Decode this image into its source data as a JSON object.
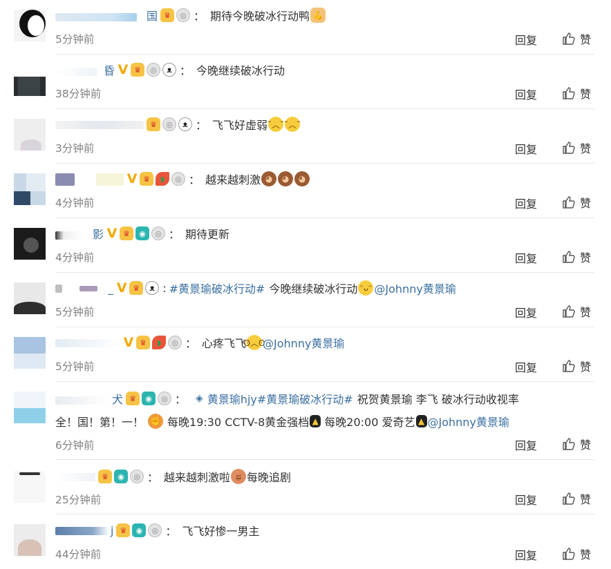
{
  "actions": {
    "reply": "回复",
    "like": "赞"
  },
  "comments": [
    {
      "name": "",
      "badges": [
        "crown",
        "medal"
      ],
      "text": "期待今晚破冰行动鸭",
      "emoji_after": [
        "arm"
      ],
      "time": "5分钟前"
    },
    {
      "name": "昏",
      "badges": [
        "v",
        "crown",
        "medal",
        "panda"
      ],
      "text": "今晚继续破冰行动",
      "time": "38分钟前"
    },
    {
      "name": "",
      "badges": [
        "crown",
        "medal",
        "panda"
      ],
      "text": "飞飞好虚弱",
      "emoji_after": [
        "sad",
        "sad"
      ],
      "time": "3分钟前"
    },
    {
      "name": "",
      "badges": [
        "v",
        "crown",
        "melon",
        "medal"
      ],
      "text": "越来越刺激",
      "emoji_after": [
        "monkey",
        "monkey",
        "monkey"
      ],
      "time": "4分钟前"
    },
    {
      "name": "影",
      "badges": [
        "v",
        "crown",
        "cam",
        "medal"
      ],
      "text": "期待更新",
      "time": "4分钟前"
    },
    {
      "name": "_",
      "badges": [
        "v",
        "crown",
        "panda"
      ],
      "hashtag": "#黄景瑜破冰行动#",
      "text": "今晚继续破冰行动",
      "emoji_after": [
        "grin"
      ],
      "mention": "@Johnny黄景瑜",
      "time": "5分钟前"
    },
    {
      "name": "",
      "badges": [
        "v",
        "crown",
        "melon",
        "medal"
      ],
      "text": "心疼飞飞",
      "emoji_after": [
        "cry"
      ],
      "mention": "@Johnny黄景瑜",
      "time": "5分钟前"
    },
    {
      "name": "犬",
      "badges": [
        "crown",
        "cam",
        "medal"
      ],
      "super_topic": "黄景瑜hjy",
      "hashtag": "#黄景瑜破冰行动#",
      "text": "祝贺黄景瑜 李飞  破冰行动收视率",
      "line2_a": "全！国！第！一！",
      "line2_b": "每晚19:30 CCTV-8黄金强档",
      "line2_c": "每晚20:00 爱奇艺",
      "mention": "@Johnny黄景瑜",
      "time": "6分钟前"
    },
    {
      "name": "",
      "badges": [
        "crown",
        "cam",
        "medal"
      ],
      "text": "越来越刺激啦",
      "emoji_after": [
        "fist"
      ],
      "text2": "每晚追剧",
      "time": "25分钟前"
    },
    {
      "name": "j",
      "badges": [
        "crown",
        "cam",
        "medal"
      ],
      "text": "飞飞好惨一男主",
      "time": "44分钟前"
    }
  ],
  "icons": {
    "like": "thumbs-up-icon",
    "super_topic": "super-topic-icon"
  },
  "colors": {
    "link": "#3b6fa0",
    "time": "#808080",
    "divider": "#e6e6e6"
  }
}
